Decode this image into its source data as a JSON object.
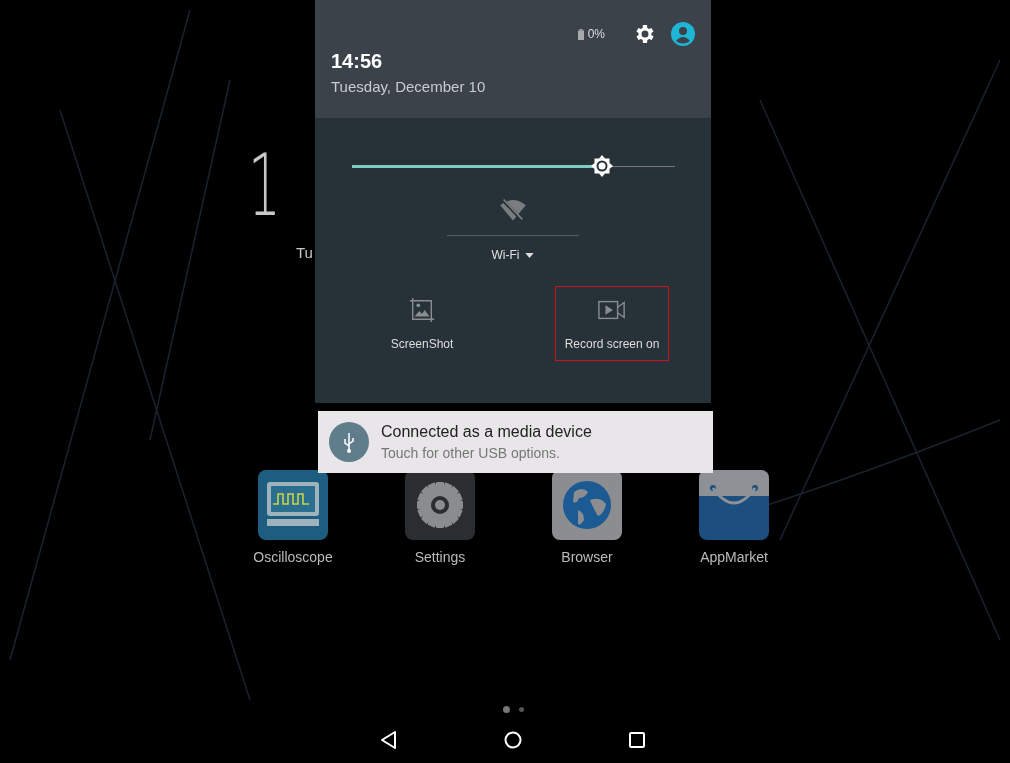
{
  "lock_clock": {
    "time": "1",
    "date": "Tu"
  },
  "apps": [
    {
      "label": "Oscilloscope",
      "kind": "oscilloscope"
    },
    {
      "label": "Settings",
      "kind": "settings"
    },
    {
      "label": "Browser",
      "kind": "browser"
    },
    {
      "label": "AppMarket",
      "kind": "market"
    }
  ],
  "pages": [
    {
      "selected": true
    },
    {
      "selected": false
    }
  ],
  "shade": {
    "battery": "0%",
    "time": "14:56",
    "date": "Tuesday, December 10",
    "brightness": {
      "level": 0.774
    },
    "wifi": {
      "label": "Wi-Fi",
      "on": false
    },
    "tiles": [
      {
        "label": "ScreenShot",
        "kind": "screenshot",
        "selected": false
      },
      {
        "label": "Record screen on",
        "kind": "record",
        "selected": true
      }
    ]
  },
  "notification": {
    "title": "Connected as a media device",
    "text": "Touch for other USB options."
  }
}
